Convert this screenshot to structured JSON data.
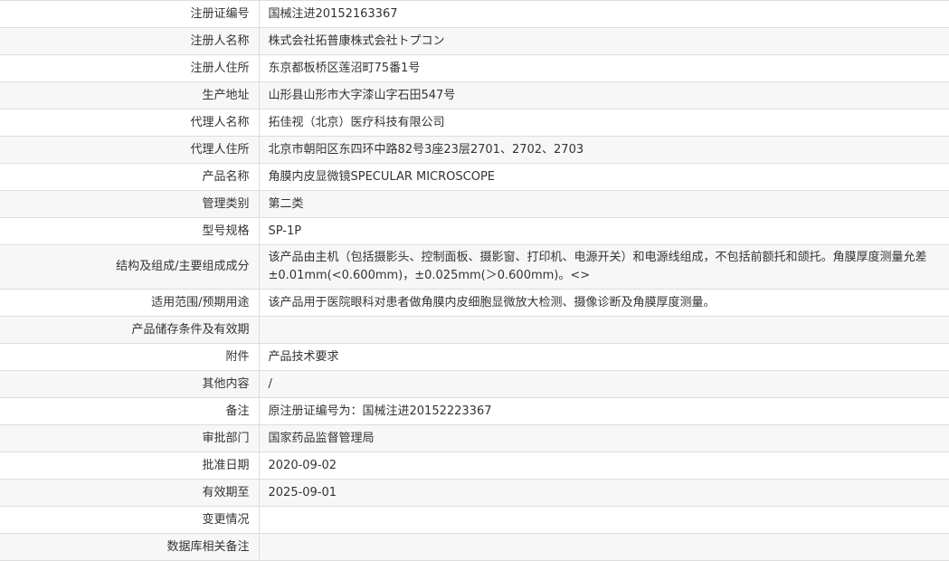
{
  "rows": [
    {
      "label": "注册证编号",
      "value": "国械注进20152163367"
    },
    {
      "label": "注册人名称",
      "value": "株式会社拓普康株式会社トプコン"
    },
    {
      "label": "注册人住所",
      "value": "东京都板桥区莲沼町75番1号"
    },
    {
      "label": "生产地址",
      "value": "山形县山形市大字漆山字石田547号"
    },
    {
      "label": "代理人名称",
      "value": "拓佳视（北京）医疗科技有限公司"
    },
    {
      "label": "代理人住所",
      "value": "北京市朝阳区东四环中路82号3座23层2701、2702、2703"
    },
    {
      "label": "产品名称",
      "value": "角膜内皮显微镜SPECULAR MICROSCOPE"
    },
    {
      "label": "管理类别",
      "value": "第二类"
    },
    {
      "label": "型号规格",
      "value": "SP-1P"
    },
    {
      "label": "结构及组成/主要组成成分",
      "value": "该产品由主机（包括摄影头、控制面板、摄影窗、打印机、电源开关）和电源线组成，不包括前额托和颌托。角膜厚度测量允差±0.01mm(<0.600mm)，±0.025mm(＞0.600mm)。<>"
    },
    {
      "label": "适用范围/预期用途",
      "value": "该产品用于医院眼科对患者做角膜内皮细胞显微放大检测、摄像诊断及角膜厚度测量。"
    },
    {
      "label": "产品储存条件及有效期",
      "value": ""
    },
    {
      "label": "附件",
      "value": "产品技术要求"
    },
    {
      "label": "其他内容",
      "value": "/"
    },
    {
      "label": "备注",
      "value": "原注册证编号为：国械注进20152223367"
    },
    {
      "label": "审批部门",
      "value": "国家药品监督管理局"
    },
    {
      "label": "批准日期",
      "value": "2020-09-02"
    },
    {
      "label": "有效期至",
      "value": "2025-09-01"
    },
    {
      "label": "变更情况",
      "value": ""
    },
    {
      "label": "数据库相关备注",
      "value": ""
    }
  ]
}
